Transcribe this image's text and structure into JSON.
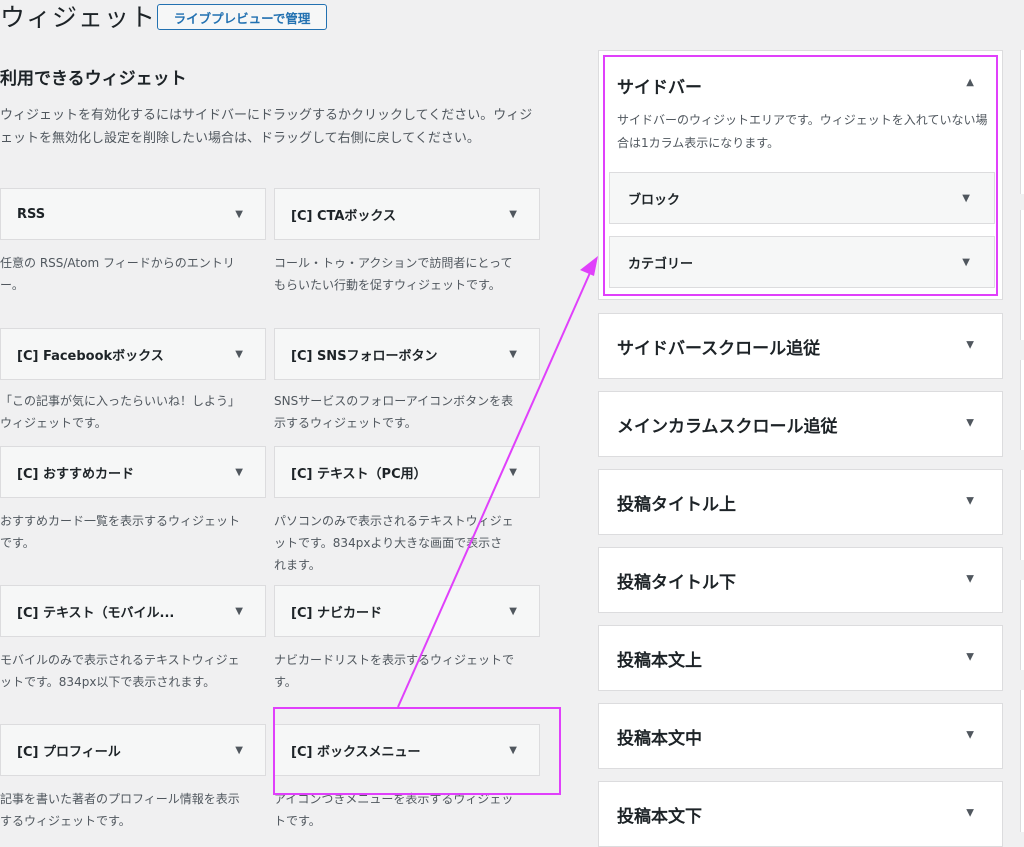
{
  "header": {
    "title": "ウィジェット",
    "manage_button": "ライブプレビューで管理"
  },
  "available": {
    "heading": "利用できるウィジェット",
    "intro": "ウィジェットを有効化するにはサイドバーにドラッグするかクリックしてください。ウィジェットを無効化し設定を削除したい場合は、ドラッグして右側に戻してください。",
    "widgets": [
      {
        "title": "RSS",
        "desc": "任意の RSS/Atom フィードからのエントリー。"
      },
      {
        "title": "[C] CTAボックス",
        "desc": "コール・トゥ・アクションで訪問者にとってもらいたい行動を促すウィジェットです。"
      },
      {
        "title": "[C] Facebookボックス",
        "desc": "「この記事が気に入ったらいいね！しよう」ウィジェットです。"
      },
      {
        "title": "[C] SNSフォローボタン",
        "desc": "SNSサービスのフォローアイコンボタンを表示するウィジェットです。"
      },
      {
        "title": "[C] おすすめカード",
        "desc": "おすすめカード一覧を表示するウィジェットです。"
      },
      {
        "title": "[C] テキスト（PC用）",
        "desc": "パソコンのみで表示されるテキストウィジェットです。834pxより大きな画面で表示されます。"
      },
      {
        "title": "[C] テキスト（モバイル...",
        "desc": "モバイルのみで表示されるテキストウィジェットです。834px以下で表示されます。"
      },
      {
        "title": "[C] ナビカード",
        "desc": "ナビカードリストを表示するウィジェットです。"
      },
      {
        "title": "[C] プロフィール",
        "desc": "記事を書いた著者のプロフィール情報を表示するウィジェットです。"
      },
      {
        "title": "[C] ボックスメニュー",
        "desc": "アイコンつきメニューを表示するウィジェットです。"
      }
    ]
  },
  "sidebar": {
    "title": "サイドバー",
    "desc": "サイドバーのウィジットエリアです。ウィジェットを入れていない場合は1カラム表示になります。",
    "widgets": [
      "ブロック",
      "カテゴリー"
    ]
  },
  "areas": [
    "サイドバースクロール追従",
    "メインカラムスクロール追従",
    "投稿タイトル上",
    "投稿タイトル下",
    "投稿本文上",
    "投稿本文中",
    "投稿本文下"
  ],
  "icons": {
    "expand": "chevron-down-icon",
    "collapse": "chevron-up-icon"
  },
  "colors": {
    "highlight": "#e040fb",
    "accent": "#2271b1"
  }
}
